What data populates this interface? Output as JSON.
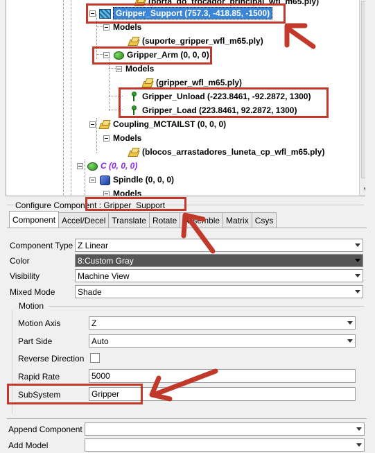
{
  "tree": {
    "top_partial": "(porta_do_trocador_principal_wfl_m65.ply)",
    "items": [
      {
        "label": "Gripper_Support (757.3, -418.85, -1500)"
      },
      {
        "label": "Models"
      },
      {
        "label": "(suporte_gripper_wfl_m65.ply)"
      },
      {
        "label": "Gripper_Arm (0, 0, 0)"
      },
      {
        "label": "Models"
      },
      {
        "label": "(gripper_wfl_m65.ply)"
      },
      {
        "label": "Gripper_Unload (-223.8461, -92.2872, 1300)"
      },
      {
        "label": "Gripper_Load (223.8461, 92.2872, 1300)"
      },
      {
        "label": "Coupling_MCTAILST (0, 0, 0)"
      },
      {
        "label": "Models"
      },
      {
        "label": "(blocos_arrastadores_luneta_cp_wfl_m65.ply)"
      },
      {
        "label": "C (0, 0, 0)"
      },
      {
        "label": "Spindle (0, 0, 0)"
      },
      {
        "label": "Models"
      }
    ]
  },
  "configure": {
    "title": "Configure Component : Gripper_Support",
    "tabs": [
      "Component",
      "Accel/Decel",
      "Translate",
      "Rotate",
      "Assemble",
      "Matrix",
      "Csys"
    ],
    "component_type": {
      "label": "Component Type",
      "value": "Z Linear"
    },
    "color": {
      "label": "Color",
      "value": "8:Custom Gray"
    },
    "visibility": {
      "label": "Visibility",
      "value": "Machine View"
    },
    "mixed_mode": {
      "label": "Mixed Mode",
      "value": "Shade"
    },
    "motion": {
      "title": "Motion",
      "motion_axis": {
        "label": "Motion Axis",
        "value": "Z"
      },
      "part_side": {
        "label": "Part Side",
        "value": "Auto"
      },
      "reverse_direction": {
        "label": "Reverse Direction",
        "checked": false
      },
      "rapid_rate": {
        "label": "Rapid Rate",
        "value": "5000"
      },
      "subsystem": {
        "label": "SubSystem",
        "value": "Gripper"
      }
    },
    "append_component": {
      "label": "Append Component",
      "value": ""
    },
    "add_model": {
      "label": "Add Model",
      "value": ""
    }
  },
  "colors": {
    "highlight": "#c0392b",
    "selection": "#3b86d6",
    "dark_combo": "#555555"
  }
}
